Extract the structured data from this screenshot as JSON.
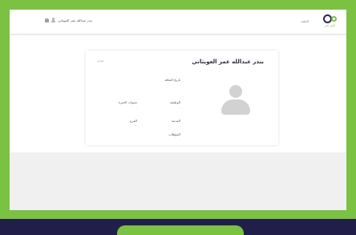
{
  "header": {
    "brand_text": "الأوفر كلين",
    "nav_label": "الملف",
    "user_name": "بندر عبدالله عمر العويثاني"
  },
  "profile": {
    "name": "بندر عبدالله عمر العويثاني",
    "edit_label": "تعديل",
    "fields": {
      "join_date_label": "تاريخ التعاقد",
      "job_label": "الوظيفة",
      "experience_label": "سنوات الخبرة",
      "city_label": "المدينة",
      "grade_label": "الفرع",
      "grade_value": "---",
      "skills_label": "المؤهلات"
    }
  },
  "icons": {
    "logo": "app-logo",
    "user": "user-icon",
    "notifications": "bell-icon",
    "avatar": "avatar-placeholder-icon"
  },
  "colors": {
    "brand_green": "#7bc142",
    "brand_navy": "#211e4a",
    "avatar_gray": "#d2d2d2"
  }
}
